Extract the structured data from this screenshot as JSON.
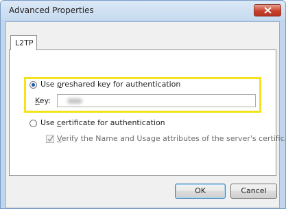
{
  "window": {
    "title": "Advanced Properties"
  },
  "tabs": [
    {
      "label": "L2TP",
      "selected": true
    }
  ],
  "options": {
    "preshared": {
      "prefix": "Use ",
      "accel": "p",
      "suffix": "reshared key for authentication",
      "selected": true
    },
    "key": {
      "accel": "K",
      "suffix": "ey:",
      "value": ""
    },
    "certificate": {
      "prefix": "Use ",
      "accel": "c",
      "suffix": "ertificate for authentication",
      "selected": false
    },
    "verify": {
      "accel": "V",
      "suffix": "erify the Name and Usage attributes of the server's certificate",
      "checked": true,
      "enabled": false
    }
  },
  "buttons": {
    "ok": "OK",
    "cancel": "Cancel"
  },
  "colors": {
    "highlight": "#f4e21a",
    "close_button": "#c9432f"
  }
}
